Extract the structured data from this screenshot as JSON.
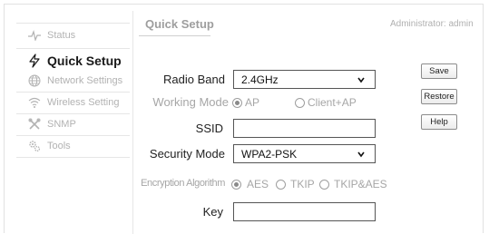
{
  "sidebar": {
    "items": [
      {
        "label": "Status",
        "icon": "pulse-icon"
      },
      {
        "label": "Quick Setup",
        "icon": "lightning-icon",
        "active": true
      },
      {
        "label": "Network Settings",
        "icon": "globe-icon"
      },
      {
        "label": "Wireless Setting",
        "icon": "wifi-icon"
      },
      {
        "label": "SNMP",
        "icon": "tools-cross-icon"
      },
      {
        "label": "Tools",
        "icon": "gears-icon"
      }
    ]
  },
  "header": {
    "title": "Quick Setup",
    "admin": "Administrator: admin"
  },
  "form": {
    "radio_band": {
      "label": "Radio Band",
      "value": "2.4GHz"
    },
    "working_mode": {
      "label": "Working Mode",
      "options": [
        "AP",
        "Client+AP"
      ],
      "selected": "AP"
    },
    "ssid": {
      "label": "SSID",
      "value": ""
    },
    "security_mode": {
      "label": "Security Mode",
      "value": "WPA2-PSK"
    },
    "encryption": {
      "label": "Encryption Algorithm",
      "options": [
        "AES",
        "TKIP",
        "TKIP&AES"
      ],
      "selected": "AES"
    },
    "key": {
      "label": "Key",
      "value": ""
    }
  },
  "buttons": {
    "save": "Save",
    "restore": "Restore",
    "help": "Help"
  },
  "colors": {
    "muted_text": "#a6a6a6",
    "border": "#555555"
  }
}
